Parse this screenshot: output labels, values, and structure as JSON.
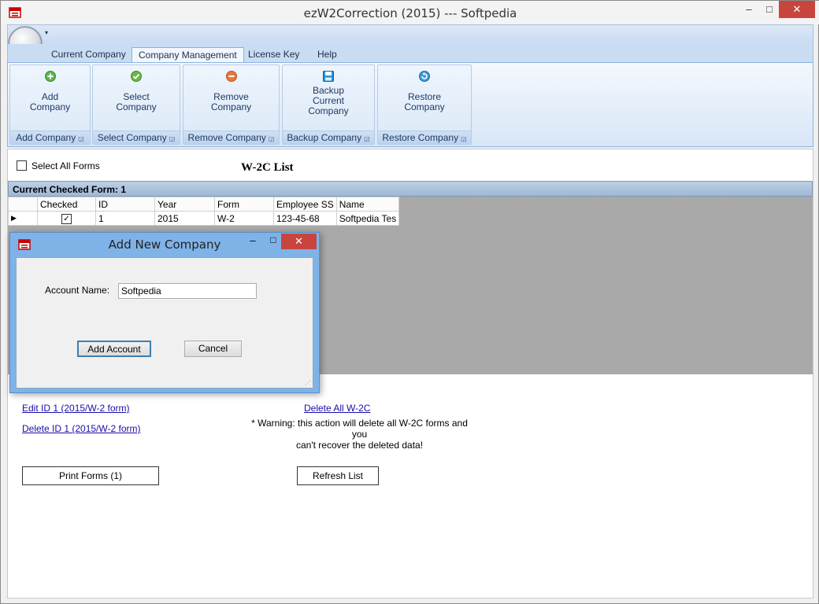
{
  "window": {
    "title": "ezW2Correction (2015) --- Softpedia"
  },
  "ribbon": {
    "qat_icon": "dropdown-arrow",
    "tabs": [
      {
        "label": "Current Company"
      },
      {
        "label": "Company Management"
      },
      {
        "label": "License Key"
      },
      {
        "label": "Help"
      }
    ],
    "groups": [
      {
        "button": "Add\nCompany",
        "name": "Add Company",
        "icon": "plus-circle-icon",
        "color": "#5bb84a"
      },
      {
        "button": "Select\nCompany",
        "name": "Select Company",
        "icon": "check-circle-icon",
        "color": "#6ab844"
      },
      {
        "button": "Remove\nCompany",
        "name": "Remove Company",
        "icon": "minus-circle-icon",
        "color": "#e8783a"
      },
      {
        "button": "Backup\nCurrent\nCompany",
        "name": "Backup Company",
        "icon": "floppy-icon",
        "color": "#2a8fd8"
      },
      {
        "button": "Restore\nCompany",
        "name": "Restore Company",
        "icon": "restore-circle-icon",
        "color": "#3a9ad8"
      }
    ]
  },
  "main": {
    "select_all_label": "Select All Forms",
    "list_title": "W-2C List",
    "current_checked": "Current Checked Form: 1",
    "grid": {
      "columns": [
        "Checked",
        "ID",
        "Year",
        "Form",
        "Employee SS",
        "Name"
      ],
      "rows": [
        {
          "checked": true,
          "id": "1",
          "year": "2015",
          "form": "W-2",
          "ssn": "123-45-68",
          "name": "Softpedia Tes"
        }
      ]
    },
    "edit_link": "Edit ID 1 (2015/W-2 form)",
    "delete_link": "Delete ID 1 (2015/W-2 form)",
    "delete_all_link": "Delete All W-2C",
    "warning_line1": "* Warning: this action will delete all W-2C forms and you",
    "warning_line2": "can't recover the deleted data!",
    "print_button": "Print Forms (1)",
    "refresh_button": "Refresh List"
  },
  "dialog": {
    "title": "Add New Company",
    "account_label": "Account Name:",
    "account_value": "Softpedia",
    "add_button": "Add Account",
    "cancel_button": "Cancel"
  }
}
